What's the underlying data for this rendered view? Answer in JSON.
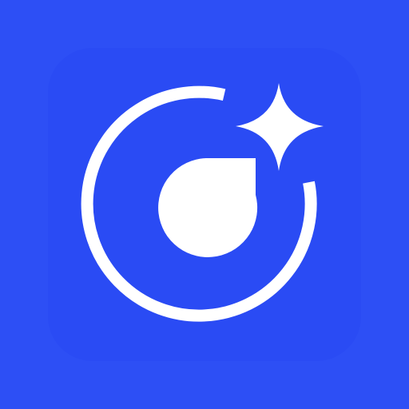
{
  "app_icon": {
    "background_color": "#2d4ff5",
    "foreground_color": "#ffffff",
    "icons": {
      "ring": "open-ring-icon",
      "droplet": "droplet-icon",
      "sparkle": "sparkle-icon"
    }
  }
}
